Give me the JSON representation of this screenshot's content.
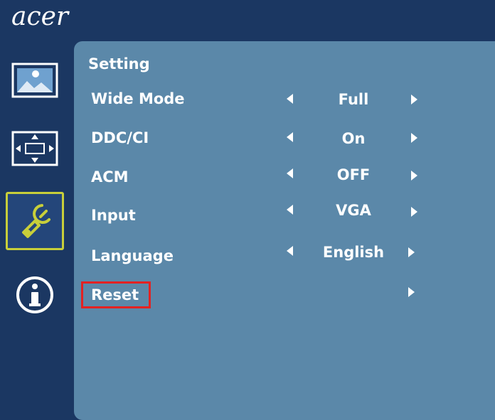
{
  "brand": {
    "logo_text": "acer"
  },
  "sidebar": {
    "tabs": [
      {
        "icon": "picture-icon",
        "active": false
      },
      {
        "icon": "position-icon",
        "active": false
      },
      {
        "icon": "setting-wrench-icon",
        "active": true
      },
      {
        "icon": "information-icon",
        "active": false
      }
    ]
  },
  "menu": {
    "title": "Setting",
    "rows": [
      {
        "label": "Wide Mode",
        "value": "Full",
        "has_left": true,
        "has_right": true
      },
      {
        "label": "DDC/CI",
        "value": "On",
        "has_left": true,
        "has_right": true
      },
      {
        "label": "ACM",
        "value": "OFF",
        "has_left": true,
        "has_right": true
      },
      {
        "label": "Input",
        "value": "VGA",
        "has_left": true,
        "has_right": true
      },
      {
        "label": "Language",
        "value": "English",
        "has_left": true,
        "has_right": true
      },
      {
        "label": "Reset",
        "value": "",
        "has_left": false,
        "has_right": true
      }
    ],
    "highlight_color": "#e32222",
    "active_tab_color": "#c8cf3a"
  }
}
